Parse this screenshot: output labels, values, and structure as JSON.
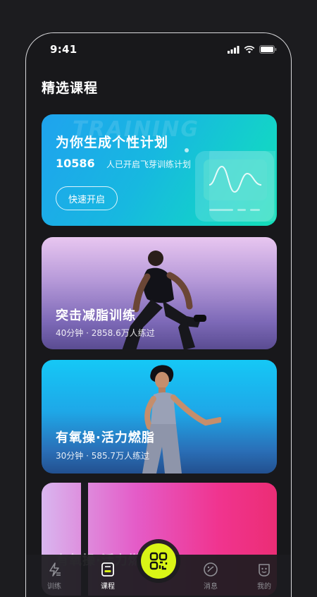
{
  "status_bar": {
    "time": "9:41"
  },
  "page_title": "精选课程",
  "hero": {
    "watermark": "TRAINING",
    "title": "为你生成个性计划",
    "count": "10586",
    "count_label": "人已开启飞芽训练计划",
    "button_label": "快速开启"
  },
  "courses": [
    {
      "title": "突击减脂训练",
      "meta": "40分钟 · 2858.6万人练过"
    },
    {
      "title": "有氧操·活力燃脂",
      "meta": "30分钟 · 585.7万人练过"
    },
    {
      "title": "有氧操·活力燃脂",
      "meta": ""
    }
  ],
  "tabbar": {
    "items": [
      {
        "label": "训练",
        "icon": "bolt-icon"
      },
      {
        "label": "课程",
        "icon": "course-icon"
      },
      {
        "label": "消息",
        "icon": "message-icon"
      },
      {
        "label": "我的",
        "icon": "profile-icon"
      }
    ],
    "scan_icon": "qr-scan-icon",
    "active": "课程"
  },
  "colors": {
    "accent": "#d9f516",
    "background": "#18181b",
    "hero_start": "#1fa3ee",
    "hero_end": "#14ddb8"
  }
}
